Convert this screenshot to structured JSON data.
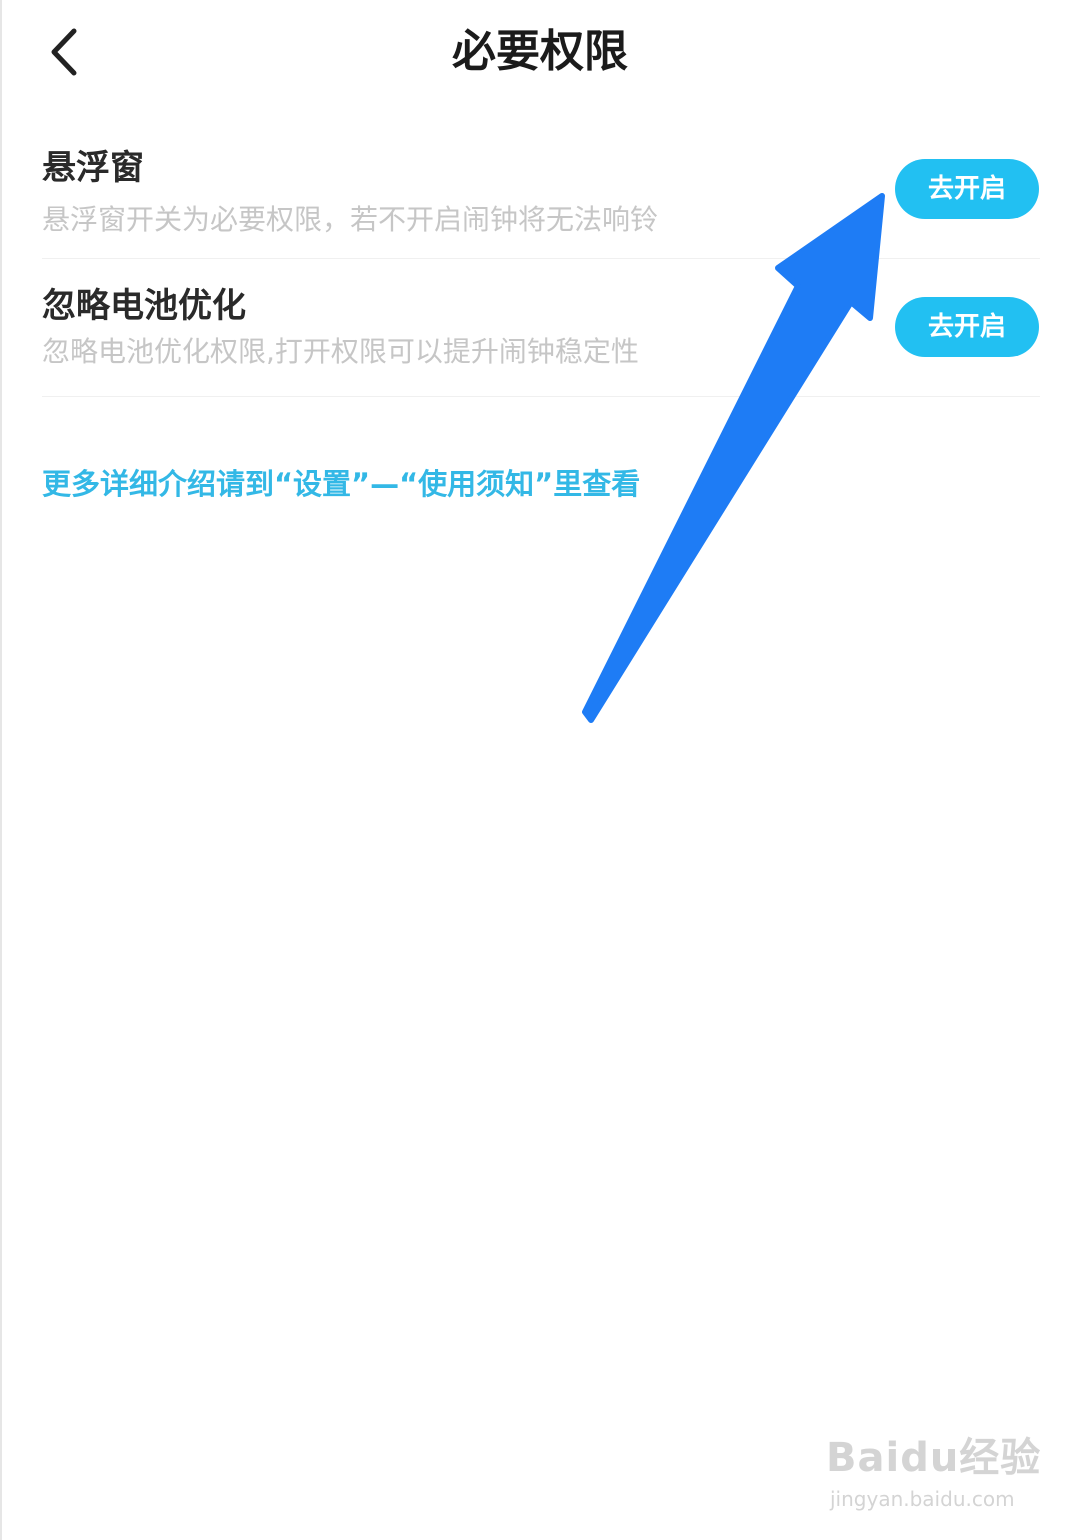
{
  "header": {
    "title": "必要权限",
    "back_icon": "chevron-left-icon"
  },
  "permissions": [
    {
      "title": "悬浮窗",
      "description": "悬浮窗开关为必要权限，若不开启闹钟将无法响铃",
      "button_label": "去开启"
    },
    {
      "title": "忽略电池优化",
      "description": "忽略电池优化权限,打开权限可以提升闹钟稳定性",
      "button_label": "去开启"
    }
  ],
  "more_info": "更多详细介绍请到“设置”—“使用须知”里查看",
  "annotation": {
    "arrow_icon": "arrow-up-right-icon",
    "color": "#1e7cf5"
  },
  "watermark": {
    "logo": "Baidu经验",
    "url": "jingyan.baidu.com"
  },
  "colors": {
    "button": "#22c0f2",
    "link": "#33b8e6",
    "description": "#c6c6c6"
  }
}
